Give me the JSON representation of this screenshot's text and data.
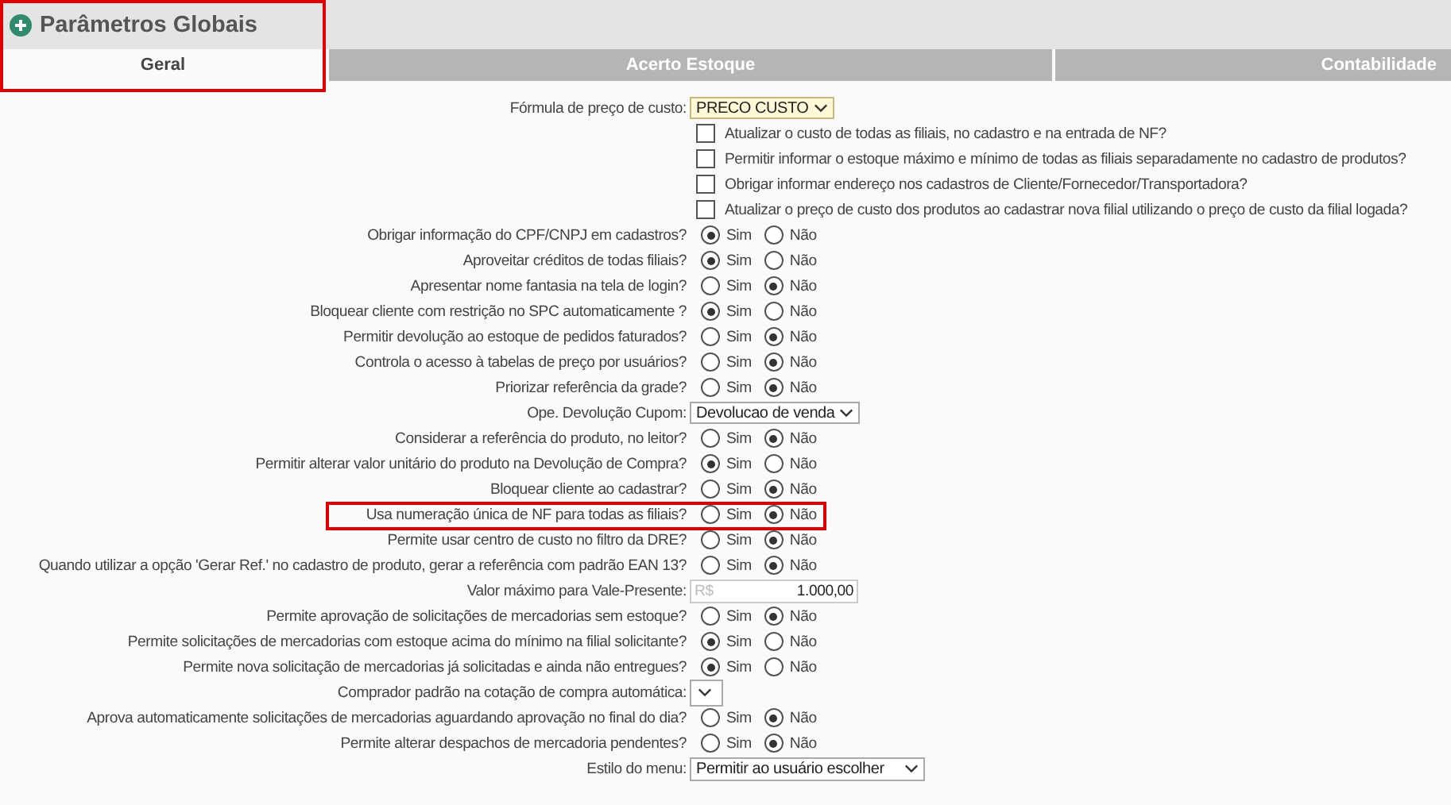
{
  "header": {
    "title": "Parâmetros Globais",
    "highlighted": true
  },
  "tabs": [
    {
      "label": "Geral",
      "selected": true
    },
    {
      "label": "Acerto Estoque",
      "selected": false
    },
    {
      "label": "Contabilidade",
      "selected": false
    }
  ],
  "rows": [
    {
      "kind": "select",
      "label": "Fórmula de preço de custo:",
      "value": "PRECO CUSTO",
      "focused": true
    },
    {
      "kind": "checkbox",
      "label": "Atualizar o custo de todas as filiais, no cadastro e na entrada de NF?",
      "checked": false
    },
    {
      "kind": "checkbox",
      "label": "Permitir informar o estoque máximo e mínimo de todas as filiais separadamente no cadastro de produtos?",
      "checked": false
    },
    {
      "kind": "checkbox",
      "label": "Obrigar informar endereço nos cadastros de Cliente/Fornecedor/Transportadora?",
      "checked": false
    },
    {
      "kind": "checkbox",
      "label": "Atualizar o preço de custo dos produtos ao cadastrar nova filial utilizando o preço de custo da filial logada?",
      "checked": false
    },
    {
      "kind": "radio",
      "label": "Obrigar informação do CPF/CNPJ em cadastros?",
      "options": [
        {
          "label": "Sim",
          "selected": true
        },
        {
          "label": "Não",
          "selected": false
        }
      ]
    },
    {
      "kind": "radio",
      "label": "Aproveitar créditos de todas filiais?",
      "options": [
        {
          "label": "Sim",
          "selected": true
        },
        {
          "label": "Não",
          "selected": false
        }
      ]
    },
    {
      "kind": "radio",
      "label": "Apresentar nome fantasia na tela de login?",
      "options": [
        {
          "label": "Sim",
          "selected": false
        },
        {
          "label": "Não",
          "selected": true
        }
      ]
    },
    {
      "kind": "radio",
      "label": "Bloquear cliente com restrição no SPC automaticamente ?",
      "options": [
        {
          "label": "Sim",
          "selected": true
        },
        {
          "label": "Não",
          "selected": false
        }
      ]
    },
    {
      "kind": "radio",
      "label": "Permitir devolução ao estoque de pedidos faturados?",
      "options": [
        {
          "label": "Sim",
          "selected": false
        },
        {
          "label": "Não",
          "selected": true
        }
      ]
    },
    {
      "kind": "radio",
      "label": "Controla o acesso à tabelas de preço por usuários?",
      "options": [
        {
          "label": "Sim",
          "selected": false
        },
        {
          "label": "Não",
          "selected": true
        }
      ]
    },
    {
      "kind": "radio",
      "label": "Priorizar referência da grade?",
      "options": [
        {
          "label": "Sim",
          "selected": false
        },
        {
          "label": "Não",
          "selected": true
        }
      ]
    },
    {
      "kind": "select",
      "label": "Ope. Devolução Cupom:",
      "value": "Devolucao de venda",
      "focused": false
    },
    {
      "kind": "radio",
      "label": "Considerar a referência do produto, no leitor?",
      "options": [
        {
          "label": "Sim",
          "selected": false
        },
        {
          "label": "Não",
          "selected": true
        }
      ]
    },
    {
      "kind": "radio",
      "label": "Permitir alterar valor unitário do produto na Devolução de Compra?",
      "options": [
        {
          "label": "Sim",
          "selected": true
        },
        {
          "label": "Não",
          "selected": false
        }
      ]
    },
    {
      "kind": "radio",
      "label": "Bloquear cliente ao cadastrar?",
      "options": [
        {
          "label": "Sim",
          "selected": false
        },
        {
          "label": "Não",
          "selected": true
        }
      ]
    },
    {
      "kind": "radio",
      "label": "Usa numeração única de NF para todas as filiais?",
      "highlighted": true,
      "options": [
        {
          "label": "Sim",
          "selected": false
        },
        {
          "label": "Não",
          "selected": true
        }
      ]
    },
    {
      "kind": "radio",
      "label": "Permite usar centro de custo no filtro da DRE?",
      "options": [
        {
          "label": "Sim",
          "selected": false
        },
        {
          "label": "Não",
          "selected": true
        }
      ]
    },
    {
      "kind": "radio",
      "label": "Quando utilizar a opção 'Gerar Ref.' no cadastro de produto, gerar a referência com padrão EAN 13?",
      "options": [
        {
          "label": "Sim",
          "selected": false
        },
        {
          "label": "Não",
          "selected": true
        }
      ]
    },
    {
      "kind": "currency",
      "label": "Valor máximo para Vale-Presente:",
      "prefix": "R$",
      "value": "1.000,00"
    },
    {
      "kind": "radio",
      "label": "Permite aprovação de solicitações de mercadorias sem estoque?",
      "options": [
        {
          "label": "Sim",
          "selected": false
        },
        {
          "label": "Não",
          "selected": true
        }
      ]
    },
    {
      "kind": "radio",
      "label": "Permite solicitações de mercadorias com estoque acima do mínimo na filial solicitante?",
      "options": [
        {
          "label": "Sim",
          "selected": true
        },
        {
          "label": "Não",
          "selected": false
        }
      ]
    },
    {
      "kind": "radio",
      "label": "Permite nova solicitação de mercadorias já solicitadas e ainda não entregues?",
      "options": [
        {
          "label": "Sim",
          "selected": true
        },
        {
          "label": "Não",
          "selected": false
        }
      ]
    },
    {
      "kind": "select",
      "label": "Comprador padrão na cotação de compra automática:",
      "focused": false
    },
    {
      "kind": "radio",
      "label": "Aprova automaticamente solicitações de mercadorias aguardando aprovação no final do dia?",
      "options": [
        {
          "label": "Sim",
          "selected": false
        },
        {
          "label": "Não",
          "selected": true
        }
      ]
    },
    {
      "kind": "radio",
      "label": "Permite alterar despachos de mercadoria pendentes?",
      "options": [
        {
          "label": "Sim",
          "selected": false
        },
        {
          "label": "Não",
          "selected": true
        }
      ]
    },
    {
      "kind": "select",
      "label": "Estilo do menu:",
      "value": "Permitir ao usuário escolher",
      "focused": false,
      "wide": true
    }
  ]
}
